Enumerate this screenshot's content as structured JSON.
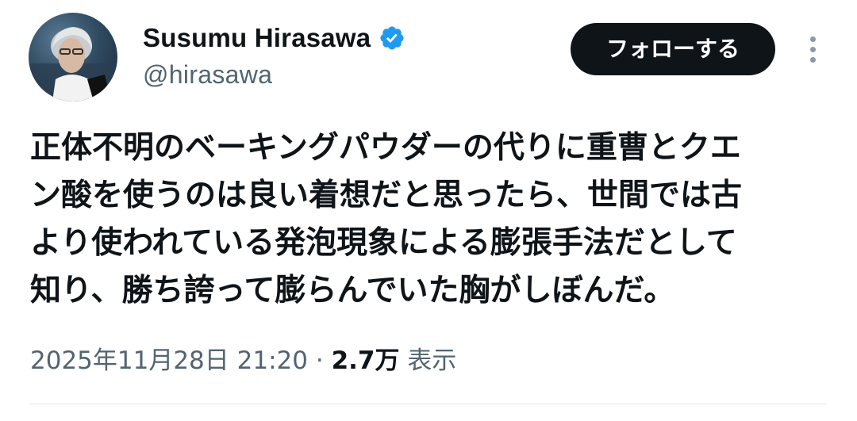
{
  "author": {
    "display_name": "Susumu Hirasawa",
    "handle": "@hirasawa",
    "verified_color": "#1d9bf0"
  },
  "actions": {
    "follow_label": "フォローする"
  },
  "tweet": {
    "lines": [
      "正体不明のベーキングパウダーの代りに重曹とクエ",
      "ン酸を使うのは良い着想だと思ったら、世間では古",
      "より使われている発泡現象による膨張手法だとして",
      "知り、勝ち誇って膨らんでいた胸がしぼんだ。"
    ]
  },
  "meta": {
    "timestamp": "2025年11月28日 21:20",
    "separator": "·",
    "views_count": "2.7万",
    "views_label": "表示"
  },
  "colors": {
    "text_primary": "#0f1419",
    "text_secondary": "#536471",
    "button_bg": "#0f1419"
  }
}
